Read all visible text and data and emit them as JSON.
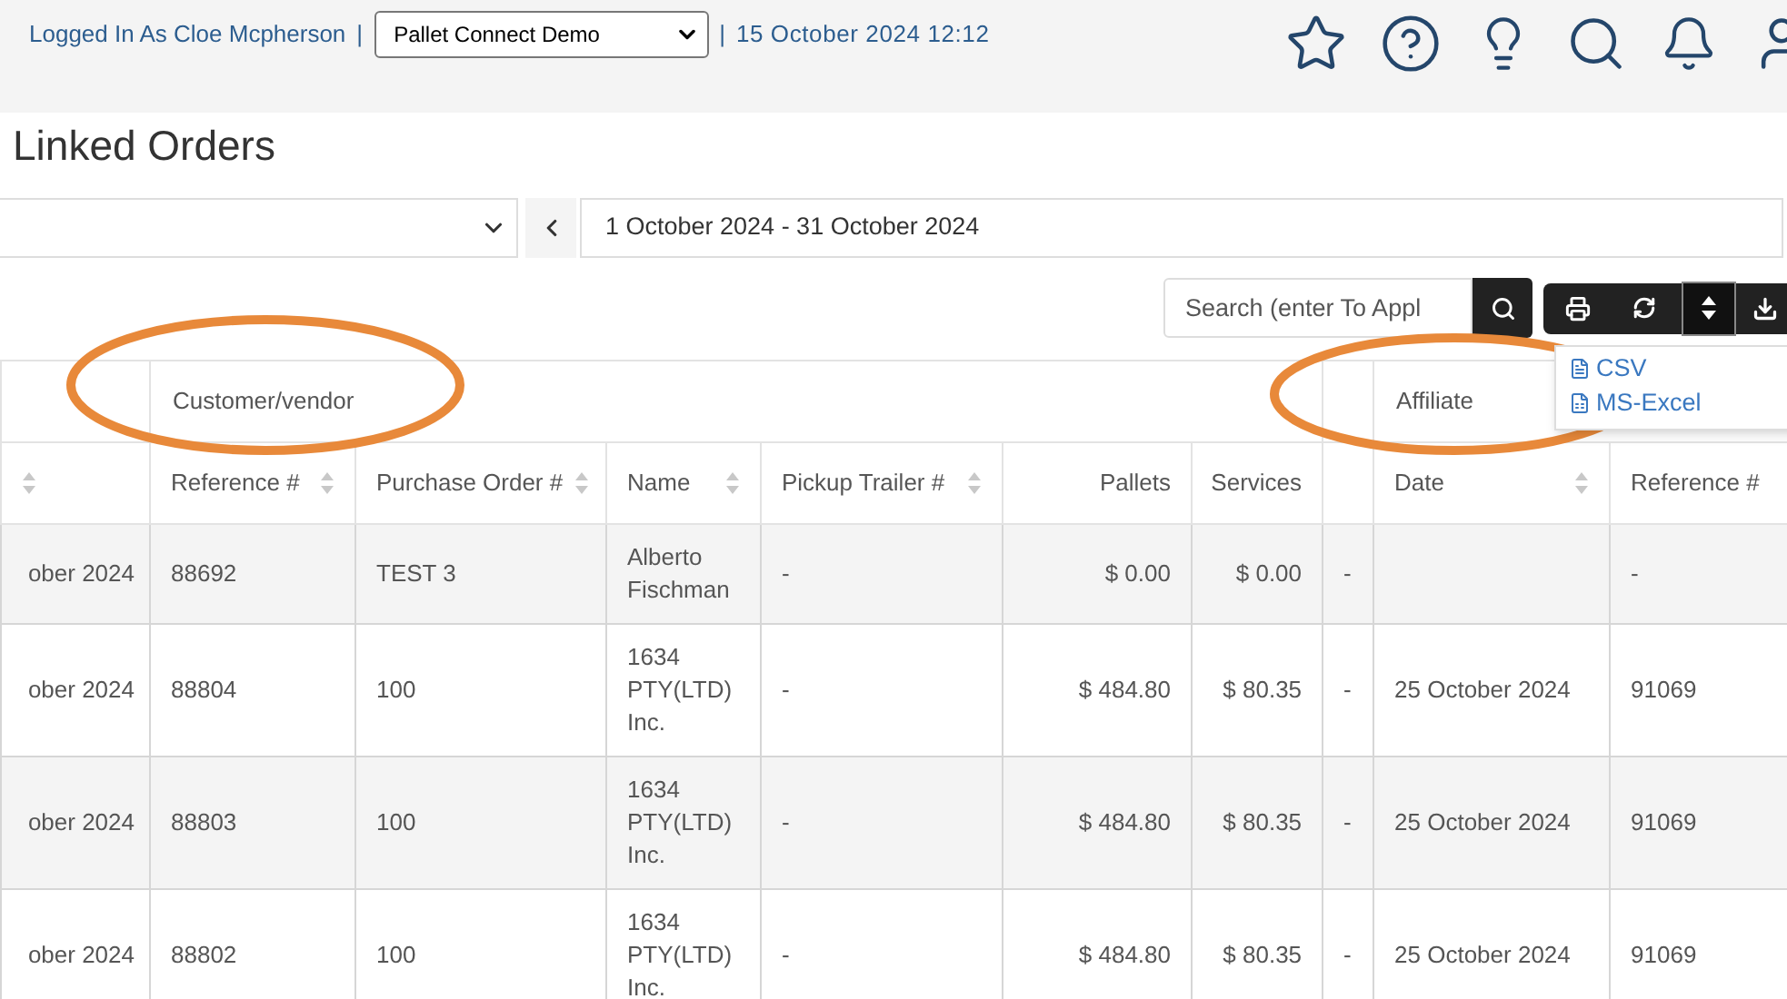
{
  "header": {
    "logged_in": "Logged In As Cloe Mcpherson",
    "separator_1": "|",
    "org_select": "Pallet Connect Demo",
    "separator_2": "|",
    "datetime": "15 October 2024 12:12"
  },
  "page_title": "Linked Orders",
  "filters": {
    "date_range": "1 October 2024 - 31 October 2024"
  },
  "search": {
    "placeholder": "Search (enter To Appl"
  },
  "export_menu": [
    {
      "label": "CSV"
    },
    {
      "label": "MS-Excel"
    }
  ],
  "table": {
    "groups": [
      {
        "kind": "blank"
      },
      {
        "kind": "label",
        "label": "Customer/vendor"
      },
      {
        "kind": "blank"
      },
      {
        "kind": "label",
        "label": "Affiliate"
      }
    ],
    "columns": [
      {
        "sortable": true
      },
      {
        "label": "Reference #",
        "sortable": true
      },
      {
        "label": "Purchase Order #",
        "sortable": true
      },
      {
        "label": "Name",
        "sortable": true
      },
      {
        "label": "Pickup Trailer #",
        "sortable": true
      },
      {
        "label": "Pallets",
        "sortable": false
      },
      {
        "label": "Services",
        "sortable": false
      },
      {
        "sortable": false
      },
      {
        "label": "Date",
        "sortable": true
      },
      {
        "label": "Reference #",
        "sortable": false
      }
    ],
    "rows": [
      [
        "ober 2024",
        "88692",
        "TEST 3",
        "Alberto Fischman",
        "-",
        "$ 0.00",
        "$ 0.00",
        "-",
        null,
        "-"
      ],
      [
        "ober 2024",
        "88804",
        "100",
        "1634 PTY(LTD) Inc.",
        "-",
        "$ 484.80",
        "$ 80.35",
        "-",
        "25 October 2024",
        "91069"
      ],
      [
        "ober 2024",
        "88803",
        "100",
        "1634 PTY(LTD) Inc.",
        "-",
        "$ 484.80",
        "$ 80.35",
        "-",
        "25 October 2024",
        "91069"
      ],
      [
        "ober 2024",
        "88802",
        "100",
        "1634 PTY(LTD) Inc.",
        "-",
        "$ 484.80",
        "$ 80.35",
        "-",
        "25 October 2024",
        "91069"
      ]
    ]
  }
}
